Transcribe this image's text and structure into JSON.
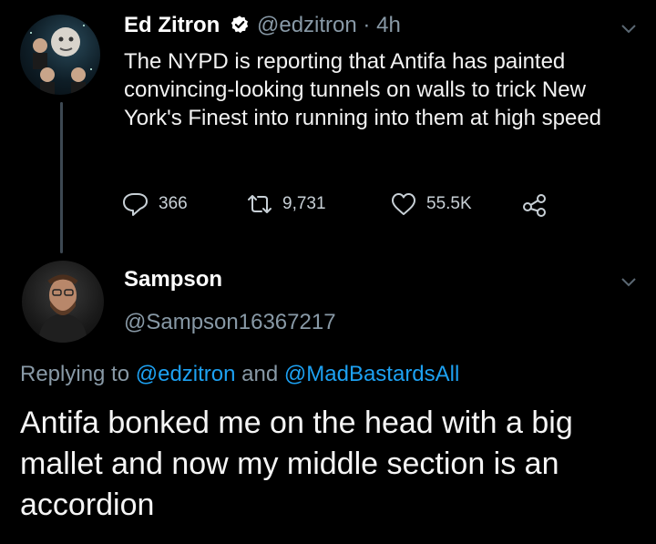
{
  "tweet": {
    "author_name": "Ed Zitron",
    "handle": "@edzitron",
    "separator": "·",
    "time": "4h",
    "text": "The NYPD is reporting that Antifa has painted convincing-looking tunnels on walls to trick New York's Finest into running into them at high speed",
    "replies": "366",
    "retweets": "9,731",
    "likes": "55.5K",
    "icons": [
      "verified-badge-icon",
      "reply-icon",
      "retweet-icon",
      "like-icon",
      "share-icon",
      "chevron-down-icon"
    ]
  },
  "reply": {
    "author_name": "Sampson",
    "handle": "@Sampson16367217",
    "replying_prefix": "Replying to",
    "replying_mention1": "@edzitron",
    "replying_and": "and",
    "replying_mention2": "@MadBastardsAll",
    "text": "Antifa bonked me on the head with a big mallet and now my middle section is an accordion"
  },
  "colors": {
    "background": "#000000",
    "text": "#ffffff",
    "secondary": "#8899a6",
    "link": "#1da1f2",
    "verified": "#ffffff"
  }
}
